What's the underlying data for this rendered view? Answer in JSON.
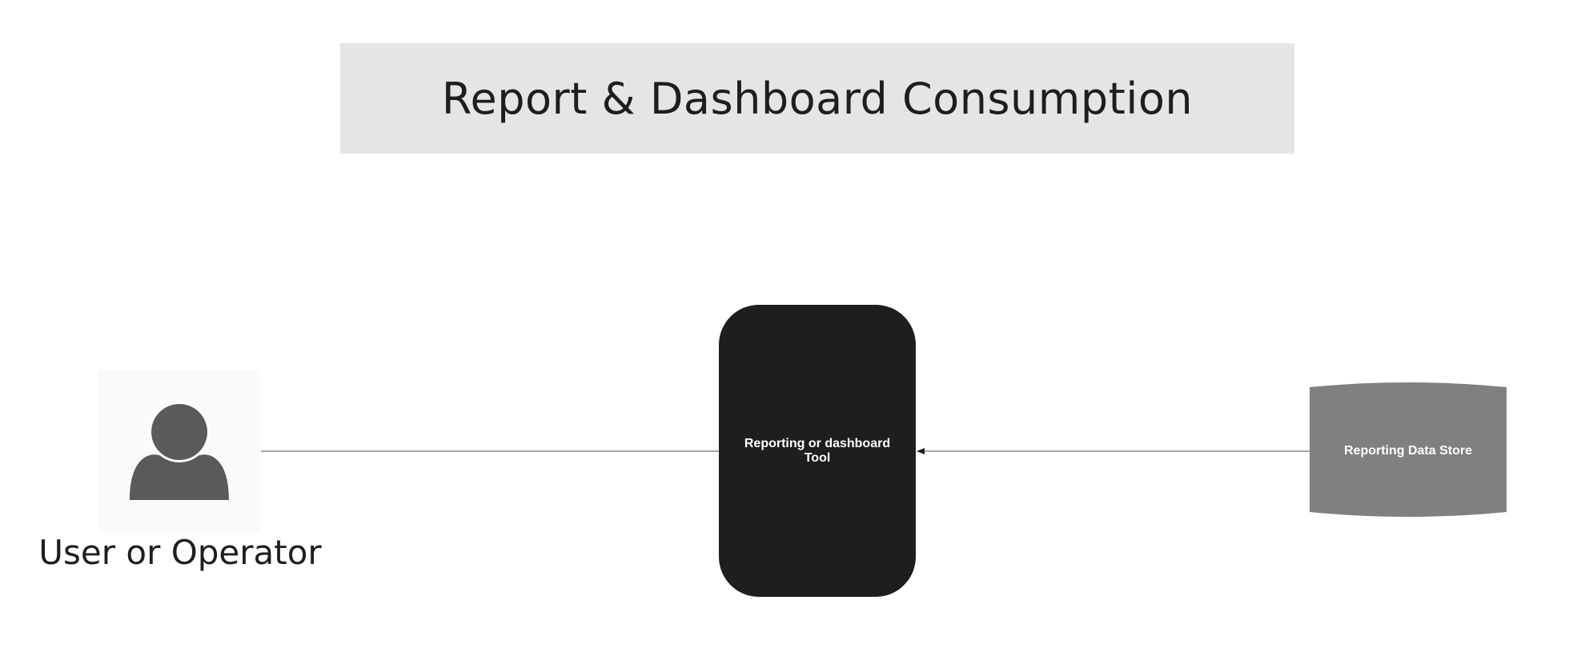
{
  "diagram": {
    "title": "Report & Dashboard Consumption",
    "nodes": {
      "user": {
        "label": "User or Operator",
        "icon": "user-icon"
      },
      "tool": {
        "label": "Reporting or dashboard Tool"
      },
      "datastore": {
        "label": "Reporting Data Store",
        "icon": "cylinder-database"
      }
    },
    "edges": [
      {
        "from": "user",
        "to": "tool",
        "arrow": "none"
      },
      {
        "from": "datastore",
        "to": "tool",
        "arrow": "end"
      }
    ],
    "colors": {
      "banner": "#e5e5e5",
      "text": "#1e1e1e",
      "tool_fill": "#1e1e1e",
      "datastore_fill": "#808080",
      "icon": "#5a5a5a",
      "connector": "#8a8a8a"
    }
  }
}
